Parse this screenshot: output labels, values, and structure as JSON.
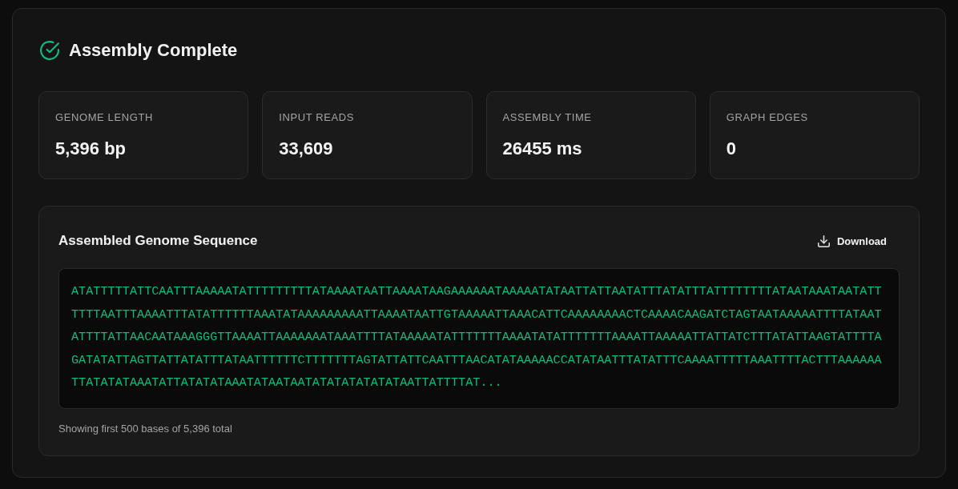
{
  "header": {
    "title": "Assembly Complete"
  },
  "stats": [
    {
      "label": "GENOME LENGTH",
      "value": "5,396 bp"
    },
    {
      "label": "INPUT READS",
      "value": "33,609"
    },
    {
      "label": "ASSEMBLY TIME",
      "value": "26455 ms"
    },
    {
      "label": "GRAPH EDGES",
      "value": "0"
    }
  ],
  "sequence_panel": {
    "title": "Assembled Genome Sequence",
    "download_button": "Download",
    "sequence": "ATATTTTTATTCAATTTAAAAATATTTTTTTTTATAAAATAATTAAAATAAGAAAAAATAAAAATATAATTATTAATATTTATATTTATTTTTTTTATAATAAATAATATTTTTTAATTTAAAATTTATATTTTTTAAATATAAAAAAAAATTAAAATAATTGTAAAAATTAAACATTCAAAAAAAACTCAAAACAAGATCTAGTAATAAAAATTTTATAATATTTTATTAACAATAAAGGGTTAAAATTAAAAAAATAAATTTTATAAAAATATTTTTTTAAAATATATTTTTTTAAAATTAAAAATTATTATCTTTATATTAAGTATTTTAGATATATTAGTTATTATATTTATAATTTTTTCTTTTTTTAGTATTATTCAATTTAACATATAAAAACCATATAATTTATATTTCAAAATTTTTAAATTTTACTTTAAAAAATTATATATAAATATTATATATAAATATAATAATATATATATATATAATTATTTTAT...",
    "footnote": "Showing first 500 bases of 5,396 total"
  }
}
